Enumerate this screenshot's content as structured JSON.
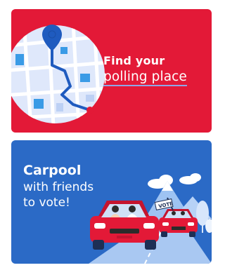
{
  "polling_card": {
    "title_line1": "Find your",
    "title_line2": "polling place",
    "icons": [
      "map-pin-icon",
      "route-map-icon"
    ],
    "colors": {
      "background": "#e31937",
      "accent": "#1f5bbf"
    }
  },
  "carpool_card": {
    "title": "Carpool",
    "line2": "with friends",
    "line3": "to vote!",
    "sign_text": "VOTE",
    "colors": {
      "background": "#2b6ac6",
      "car": "#e31937"
    }
  }
}
